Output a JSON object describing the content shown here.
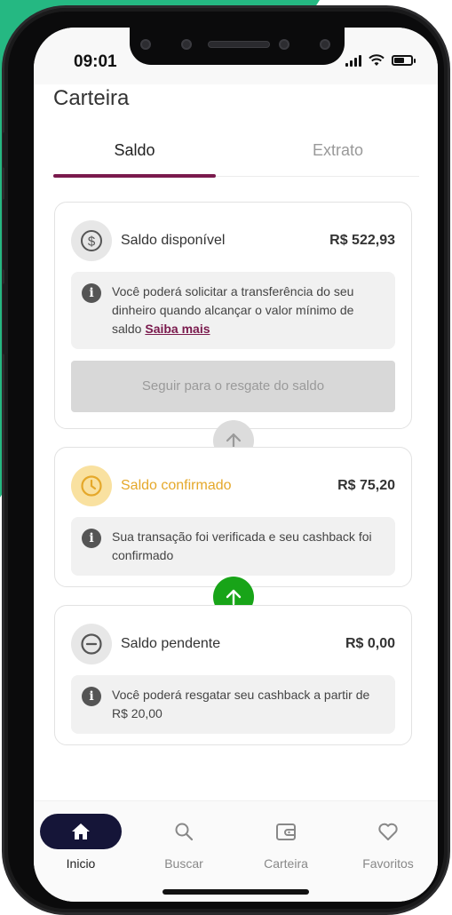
{
  "status_bar": {
    "time": "09:01"
  },
  "page_title": "Carteira",
  "tabs": [
    {
      "label": "Saldo",
      "active": true
    },
    {
      "label": "Extrato",
      "active": false
    }
  ],
  "cards": {
    "disponivel": {
      "icon": "dollar-circle-icon",
      "label": "Saldo disponível",
      "value": "R$ 522,93",
      "info_text": "Você poderá solicitar a transferência do seu dinheiro quando alcançar o valor mínimo de saldo",
      "info_link": "Saiba mais",
      "button_label": "Seguir para o resgate do saldo"
    },
    "confirmado": {
      "icon": "clock-icon",
      "label": "Saldo confirmado",
      "value": "R$ 75,20",
      "info_text": "Sua transação foi verificada e seu cashback foi confirmado"
    },
    "pendente": {
      "icon": "minus-circle-icon",
      "label": "Saldo pendente",
      "value": "R$ 0,00",
      "info_text": "Você poderá resgatar seu cashback a partir de R$ 20,00"
    }
  },
  "nav": [
    {
      "label": "Inicio",
      "icon": "home-icon",
      "active": true
    },
    {
      "label": "Buscar",
      "icon": "search-icon",
      "active": false
    },
    {
      "label": "Carteira",
      "icon": "wallet-icon",
      "active": false
    },
    {
      "label": "Favoritos",
      "icon": "heart-icon",
      "active": false
    }
  ],
  "colors": {
    "background_accent": "#25b882",
    "brand": "#7a1a4d",
    "confirmed": "#e5a82a",
    "transfer_arrow": "#18a418",
    "nav_active": "#151538"
  }
}
